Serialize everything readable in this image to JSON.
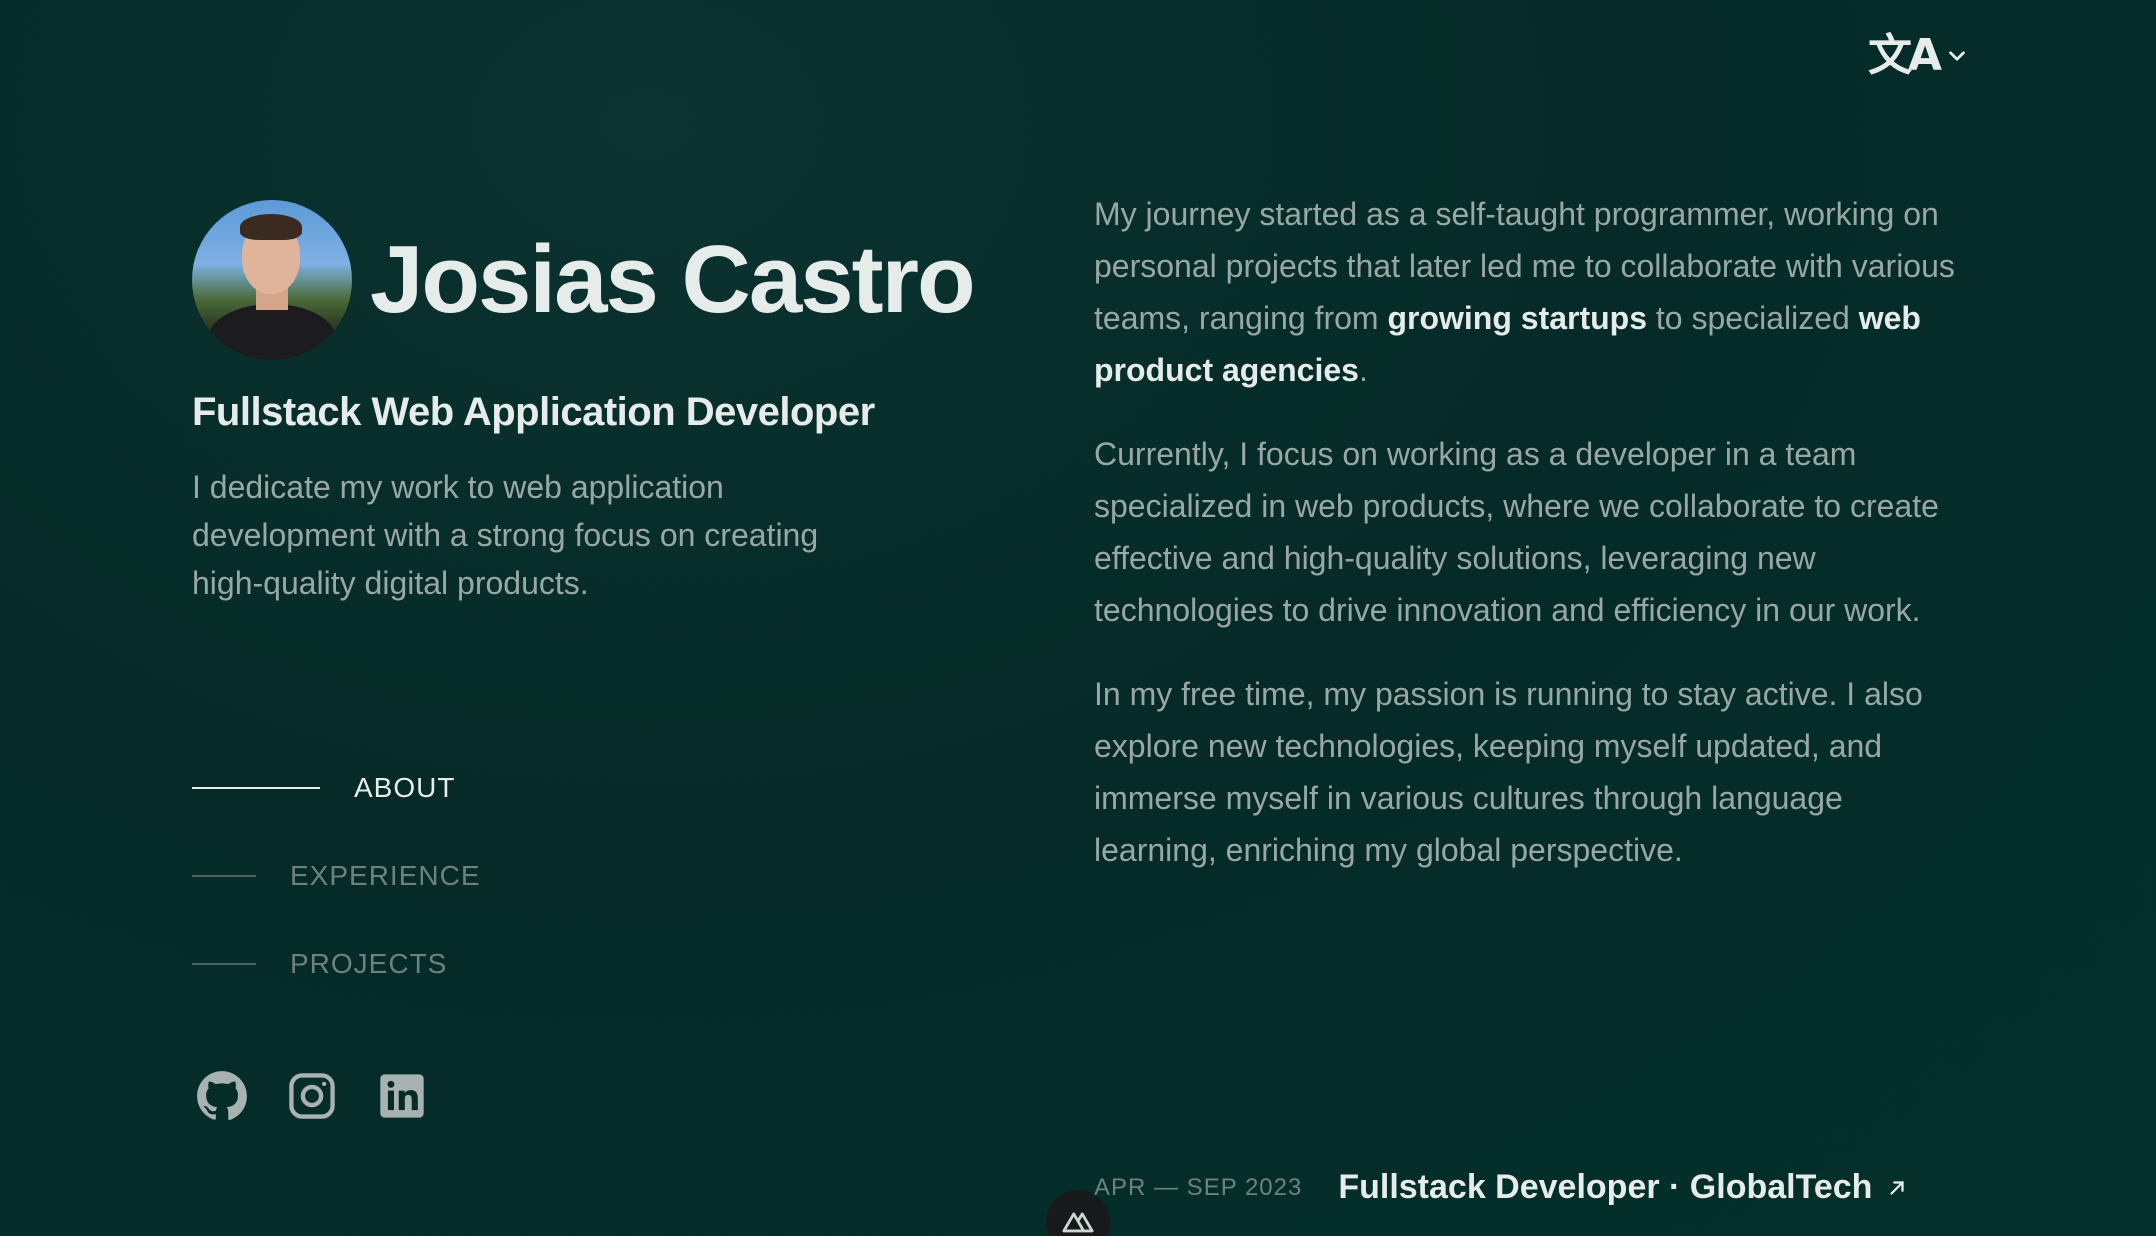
{
  "language_switcher": {
    "icon": "translate-icon",
    "glyph": "文A"
  },
  "profile": {
    "name": "Josias Castro",
    "role": "Fullstack Web Application Developer",
    "tagline": "I dedicate my work to web application development with a strong focus on creating high-quality digital products."
  },
  "nav": {
    "items": [
      {
        "label": "ABOUT",
        "active": true
      },
      {
        "label": "EXPERIENCE",
        "active": false
      },
      {
        "label": "PROJECTS",
        "active": false
      }
    ]
  },
  "socials": [
    {
      "icon": "github-icon"
    },
    {
      "icon": "instagram-icon"
    },
    {
      "icon": "linkedin-icon"
    }
  ],
  "about": {
    "p1_a": "My journey started as a self-taught programmer, working on personal projects that later led me to collaborate with various teams, ranging from ",
    "p1_b1": "growing startups",
    "p1_c": " to specialized ",
    "p1_b2": "web product agencies",
    "p1_d": ".",
    "p2": "Currently, I focus on working as a developer in a team specialized in web products, where we collaborate to create effective and high-quality solutions, leveraging new technologies to drive innovation and efficiency in our work.",
    "p3": "In my free time, my passion is running to stay active. I also explore new technologies, keeping myself updated, and immerse myself in various cultures through language learning, enriching my global perspective."
  },
  "experience": {
    "date": "APR — SEP 2023",
    "title": "Fullstack Developer · GlobalTech"
  },
  "colors": {
    "background": "#052a27",
    "text_primary": "#e6ecea",
    "text_muted": "#9aa8a5"
  }
}
